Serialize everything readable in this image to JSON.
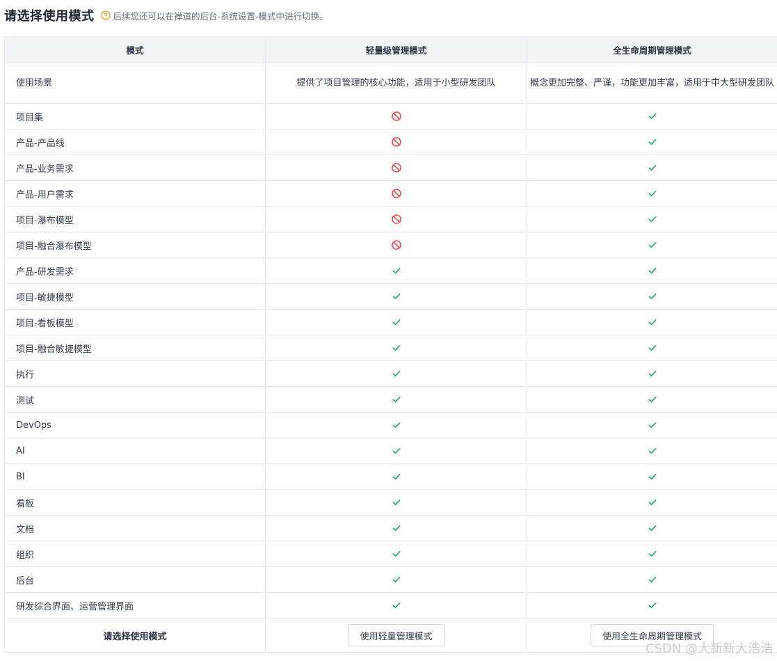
{
  "header": {
    "title": "请选择使用模式",
    "hint": "后续您还可以在禅道的后台-系统设置-模式中进行切换。",
    "help_icon": "question-circle-icon",
    "help_color": "#f0a020"
  },
  "table": {
    "columns": [
      "模式",
      "轻量级管理模式",
      "全生命周期管理模式"
    ],
    "scenario": {
      "label": "使用场景",
      "light": "提供了项目管理的核心功能，适用于小型研发团队",
      "full": "概念更加完整、严谨，功能更加丰富，适用于中大型研发团队"
    },
    "rows": [
      {
        "label": "项目集",
        "light": "no",
        "full": "yes"
      },
      {
        "label": "产品-产品线",
        "light": "no",
        "full": "yes"
      },
      {
        "label": "产品-业务需求",
        "light": "no",
        "full": "yes"
      },
      {
        "label": "产品-用户需求",
        "light": "no",
        "full": "yes"
      },
      {
        "label": "项目-瀑布模型",
        "light": "no",
        "full": "yes"
      },
      {
        "label": "项目-融合瀑布模型",
        "light": "no",
        "full": "yes"
      },
      {
        "label": "产品-研发需求",
        "light": "yes",
        "full": "yes"
      },
      {
        "label": "项目-敏捷模型",
        "light": "yes",
        "full": "yes"
      },
      {
        "label": "项目-看板模型",
        "light": "yes",
        "full": "yes"
      },
      {
        "label": "项目-融合敏捷模型",
        "light": "yes",
        "full": "yes"
      },
      {
        "label": "执行",
        "light": "yes",
        "full": "yes"
      },
      {
        "label": "测试",
        "light": "yes",
        "full": "yes"
      },
      {
        "label": "DevOps",
        "light": "yes",
        "full": "yes"
      },
      {
        "label": "AI",
        "light": "yes",
        "full": "yes"
      },
      {
        "label": "BI",
        "light": "yes",
        "full": "yes"
      },
      {
        "label": "看板",
        "light": "yes",
        "full": "yes"
      },
      {
        "label": "文档",
        "light": "yes",
        "full": "yes"
      },
      {
        "label": "组织",
        "light": "yes",
        "full": "yes"
      },
      {
        "label": "后台",
        "light": "yes",
        "full": "yes"
      },
      {
        "label": "研发综合界面、运营管理界面",
        "light": "yes",
        "full": "yes"
      }
    ],
    "footer": {
      "label": "请选择使用模式",
      "light_button": "使用轻量管理模式",
      "full_button": "使用全生命周期管理模式"
    }
  },
  "icons": {
    "yes": "check-icon",
    "no": "forbidden-icon"
  },
  "colors": {
    "yes": "#2fb56a",
    "no": "#f04b4b",
    "header_bg": "#f2f3f5",
    "border": "#e6e9ef"
  },
  "watermark": "CSDN @大新新大浩浩"
}
